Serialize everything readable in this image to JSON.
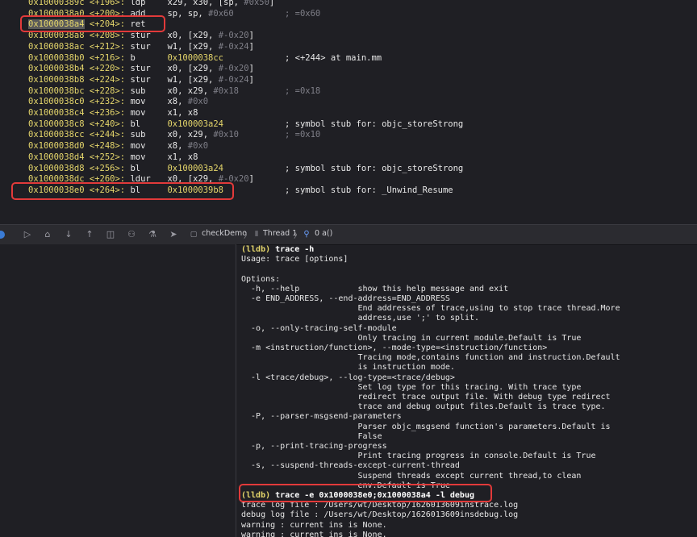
{
  "disassembly": [
    {
      "addr": "0x10000389c",
      "off": "<+196>:",
      "mn": "ldp",
      "ops": "x29, x30, [sp, ",
      "imm": "#0x50",
      "tail": "]",
      "comment": ""
    },
    {
      "addr": "0x1000038a0",
      "off": "<+200>:",
      "mn": "add",
      "ops": "sp, sp, ",
      "imm": "#0x60",
      "tail": "",
      "comment": "; =0x60",
      "comment_dim": true
    },
    {
      "addr": "0x1000038a4",
      "off": "<+204>:",
      "mn": "ret",
      "ops": "",
      "imm": "",
      "tail": "",
      "comment": ""
    },
    {
      "addr": "0x1000038a8",
      "off": "<+208>:",
      "mn": "stur",
      "ops": "x0, [x29, ",
      "imm": "#-0x20",
      "tail": "]",
      "comment": ""
    },
    {
      "addr": "0x1000038ac",
      "off": "<+212>:",
      "mn": "stur",
      "ops": "w1, [x29, ",
      "imm": "#-0x24",
      "tail": "]",
      "comment": ""
    },
    {
      "addr": "0x1000038b0",
      "off": "<+216>:",
      "mn": "b",
      "ops": "",
      "imm": "0x1000038cc",
      "tail": "",
      "comment": "; <+244> at main.mm",
      "comment_dim": false
    },
    {
      "addr": "0x1000038b4",
      "off": "<+220>:",
      "mn": "stur",
      "ops": "x0, [x29, ",
      "imm": "#-0x20",
      "tail": "]",
      "comment": ""
    },
    {
      "addr": "0x1000038b8",
      "off": "<+224>:",
      "mn": "stur",
      "ops": "w1, [x29, ",
      "imm": "#-0x24",
      "tail": "]",
      "comment": ""
    },
    {
      "addr": "0x1000038bc",
      "off": "<+228>:",
      "mn": "sub",
      "ops": "x0, x29, ",
      "imm": "#0x18",
      "tail": "",
      "comment": "; =0x18",
      "comment_dim": true
    },
    {
      "addr": "0x1000038c0",
      "off": "<+232>:",
      "mn": "mov",
      "ops": "x8, ",
      "imm": "#0x0",
      "tail": "",
      "comment": ""
    },
    {
      "addr": "0x1000038c4",
      "off": "<+236>:",
      "mn": "mov",
      "ops": "x1, x8",
      "imm": "",
      "tail": "",
      "comment": ""
    },
    {
      "addr": "0x1000038c8",
      "off": "<+240>:",
      "mn": "bl",
      "ops": "",
      "imm": "0x100003a24",
      "tail": "",
      "comment": "; symbol stub for: objc_storeStrong",
      "comment_dim": false
    },
    {
      "addr": "0x1000038cc",
      "off": "<+244>:",
      "mn": "sub",
      "ops": "x0, x29, ",
      "imm": "#0x10",
      "tail": "",
      "comment": "; =0x10",
      "comment_dim": true
    },
    {
      "addr": "0x1000038d0",
      "off": "<+248>:",
      "mn": "mov",
      "ops": "x8, ",
      "imm": "#0x0",
      "tail": "",
      "comment": ""
    },
    {
      "addr": "0x1000038d4",
      "off": "<+252>:",
      "mn": "mov",
      "ops": "x1, x8",
      "imm": "",
      "tail": "",
      "comment": ""
    },
    {
      "addr": "0x1000038d8",
      "off": "<+256>:",
      "mn": "bl",
      "ops": "",
      "imm": "0x100003a24",
      "tail": "",
      "comment": "; symbol stub for: objc_storeStrong",
      "comment_dim": false
    },
    {
      "addr": "0x1000038dc",
      "off": "<+260>:",
      "mn": "ldur",
      "ops": "x0, [x29, ",
      "imm": "#-0x20",
      "tail": "]",
      "comment": ""
    },
    {
      "addr": "0x1000038e0",
      "off": "<+264>:",
      "mn": "bl",
      "ops": "",
      "imm": "0x1000039b8",
      "tail": "",
      "comment": "; symbol stub for: _Unwind_Resume",
      "comment_dim": false
    }
  ],
  "debug_bar": {
    "scheme": "checkDemo",
    "thread": "Thread 1",
    "frame": "0 a()"
  },
  "console": [
    {
      "prompt": "(lldb)",
      "cmd": "trace -h"
    },
    {
      "text": "Usage: trace [options]"
    },
    {
      "text": ""
    },
    {
      "text": "Options:"
    },
    {
      "text": "  -h, --help            show this help message and exit"
    },
    {
      "text": "  -e END_ADDRESS, --end-address=END_ADDRESS"
    },
    {
      "text": "                        End addresses of trace,using to stop trace thread.More"
    },
    {
      "text": "                        address,use ';' to split."
    },
    {
      "text": "  -o, --only-tracing-self-module"
    },
    {
      "text": "                        Only tracing in current module.Default is True"
    },
    {
      "text": "  -m <instruction/function>, --mode-type=<instruction/function>"
    },
    {
      "text": "                        Tracing mode,contains function and instruction.Default"
    },
    {
      "text": "                        is instruction mode."
    },
    {
      "text": "  -l <trace/debug>, --log-type=<trace/debug>"
    },
    {
      "text": "                        Set log type for this tracing. With trace type"
    },
    {
      "text": "                        redirect trace output file. With debug type redirect"
    },
    {
      "text": "                        trace and debug output files.Default is trace type."
    },
    {
      "text": "  -P, --parser-msgsend-parameters"
    },
    {
      "text": "                        Parser objc_msgsend function's parameters.Default is"
    },
    {
      "text": "                        False"
    },
    {
      "text": "  -p, --print-tracing-progress"
    },
    {
      "text": "                        Print tracing progress in console.Default is True"
    },
    {
      "text": "  -s, --suspend-threads-except-current-thread"
    },
    {
      "text": "                        Suspend threads except current thread,to clean"
    },
    {
      "text": "                        env.Default is True"
    },
    {
      "prompt": "(lldb)",
      "cmd": "trace -e 0x1000038e0;0x1000038a4 -l debug"
    },
    {
      "text": "trace log file : /Users/wt/Desktop/1626013609instrace.log"
    },
    {
      "text": "debug log file : /Users/wt/Desktop/1626013609insdebug.log"
    },
    {
      "text": "warning : current ins is None."
    },
    {
      "text": "warning : current ins is None."
    }
  ]
}
